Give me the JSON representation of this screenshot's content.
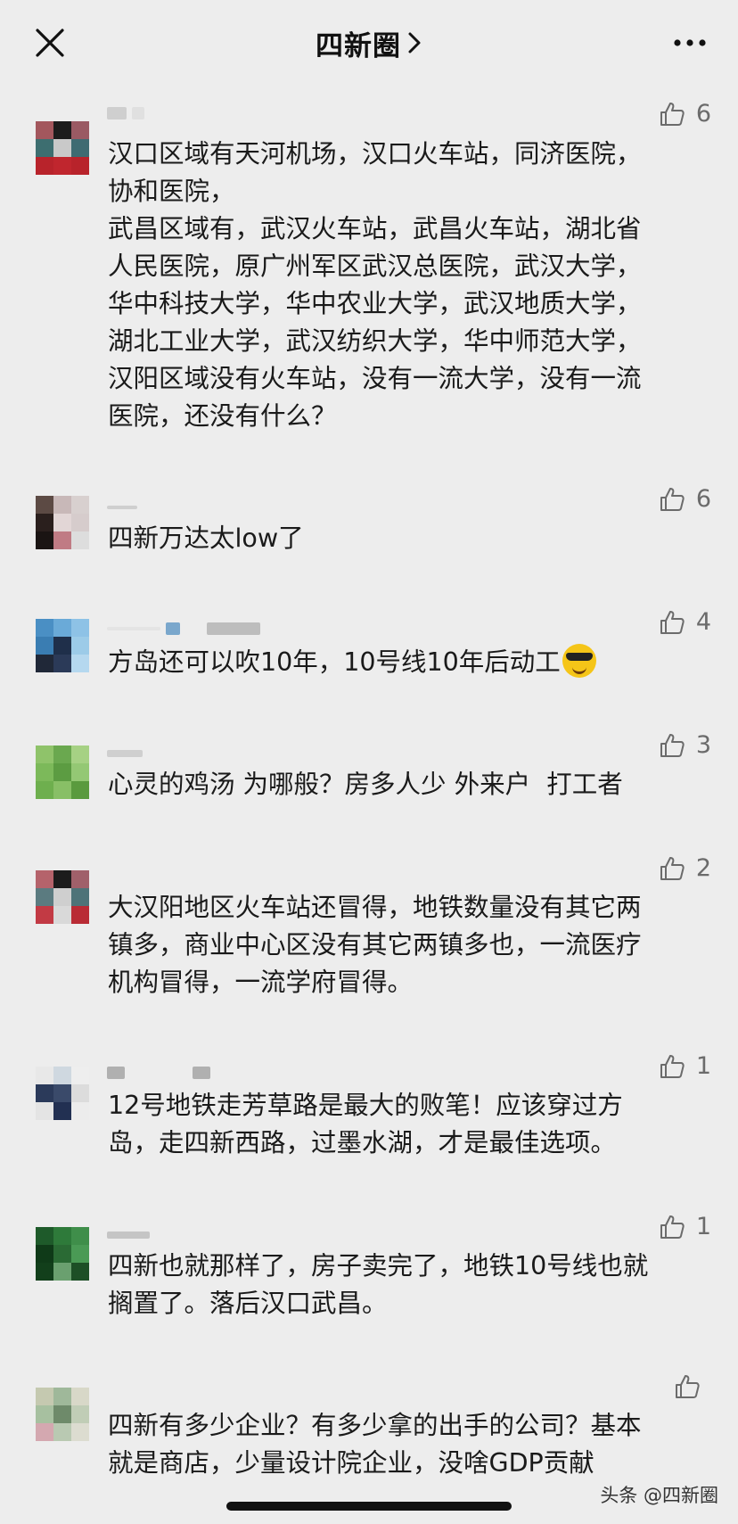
{
  "header": {
    "title": "四新圈",
    "close_icon": "close-icon",
    "chevron_icon": "chevron-right-icon",
    "more_icon": "more-icon"
  },
  "comments": [
    {
      "likes": "6",
      "text": "汉口区域有天河机场，汉口火车站，同济医院，\n协和医院，\n武昌区域有，武汉火车站，武昌火车站，湖北省\n人民医院，原广州军区武汉总医院，武汉大学，\n华中科技大学，华中农业大学，武汉地质大学，\n湖北工业大学，武汉纺织大学，华中师范大学，\n汉阳区域没有火车站，没有一流大学，没有一流\n医院，还没有什么？"
    },
    {
      "likes": "6",
      "text": "四新万达太low了"
    },
    {
      "likes": "4",
      "text": "方岛还可以吹10年，10号线10年后动工"
    },
    {
      "likes": "3",
      "text": "心灵的鸡汤 为哪般？房多人少 外来户  打工者"
    },
    {
      "likes": "2",
      "text": "大汉阳地区火车站还冒得，地铁数量没有其它两\n镇多，商业中心区没有其它两镇多也，一流医疗\n机构冒得，一流学府冒得。"
    },
    {
      "likes": "1",
      "text": "12号地铁走芳草路是最大的败笔！应该穿过方\n岛，走四新西路，过墨水湖，才是最佳选项。"
    },
    {
      "likes": "1",
      "text": "四新也就那样了，房子卖完了，地铁10号线也就\n搁置了。落后汉口武昌。"
    },
    {
      "likes": "",
      "text": "四新有多少企业？有多少拿的出手的公司？基本\n就是商店，少量设计院企业，没啥GDP贡献"
    }
  ],
  "emoji_icon": "sunglasses-emoji-icon",
  "watermark": "头条 @四新圈",
  "colors": {
    "background": "#ededed",
    "text": "#1a1a1a",
    "like": "#6b6b6b"
  }
}
